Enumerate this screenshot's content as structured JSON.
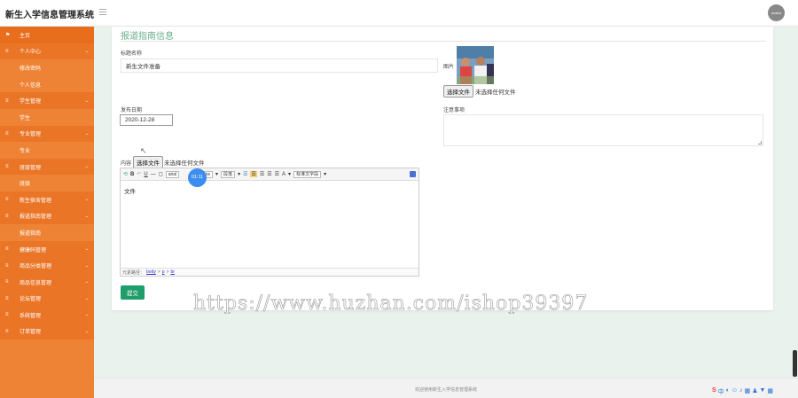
{
  "app": {
    "title": "新生入学信息管理系统",
    "avatar_text": "avatar"
  },
  "sidebar": {
    "items": [
      {
        "label": "主页",
        "type": "home",
        "icon": "flag-icon"
      },
      {
        "label": "个人中心",
        "type": "group",
        "icon": "menu-icon"
      },
      {
        "label": "修改密码",
        "type": "child"
      },
      {
        "label": "个人信息",
        "type": "child"
      },
      {
        "label": "学生管理",
        "type": "group",
        "icon": "menu-icon"
      },
      {
        "label": "学生",
        "type": "child"
      },
      {
        "label": "专业管理",
        "type": "group",
        "icon": "menu-icon"
      },
      {
        "label": "专业",
        "type": "child"
      },
      {
        "label": "班级管理",
        "type": "group",
        "icon": "menu-icon"
      },
      {
        "label": "班级",
        "type": "child"
      },
      {
        "label": "新生宿舍管理",
        "type": "group",
        "icon": "menu-icon"
      },
      {
        "label": "报道指南管理",
        "type": "group",
        "icon": "menu-icon"
      },
      {
        "label": "报道指南",
        "type": "child"
      },
      {
        "label": "健康码管理",
        "type": "group",
        "icon": "menu-icon"
      },
      {
        "label": "商品分类管理",
        "type": "group",
        "icon": "menu-icon"
      },
      {
        "label": "商品信息管理",
        "type": "group",
        "icon": "menu-icon"
      },
      {
        "label": "论坛管理",
        "type": "group",
        "icon": "menu-icon"
      },
      {
        "label": "系统管理",
        "type": "group",
        "icon": "menu-icon"
      },
      {
        "label": "订单管理",
        "type": "group",
        "icon": "menu-icon"
      }
    ]
  },
  "form": {
    "section_title": "报道指南信息",
    "title_label": "标题名称",
    "title_value": "新生文件准备",
    "image_label": "图片",
    "file_button": "选择文件",
    "no_file": "未选择任何文件",
    "date_label": "发布日期",
    "date_value": "2020-12-28",
    "notes_label": "注意事项",
    "content_label": "内容",
    "submit_label": "提交"
  },
  "editor": {
    "font_name": "arial",
    "font_size": "16px",
    "paragraph": "段落",
    "custom_title": "标准文字段",
    "body_text": "文件",
    "path_label": "元素路径：",
    "path_items": [
      "body",
      "p",
      "br"
    ],
    "path_sep": ">"
  },
  "overlay": {
    "timer": "01:11",
    "watermark": "https://www.huzhan.com/ishop39397"
  },
  "footer": {
    "text": "欢迎使用新生入学信息管理系统"
  },
  "colors": {
    "sidebar": "#ef8335",
    "accent": "#6dae8b",
    "submit": "#1f9d6a"
  }
}
